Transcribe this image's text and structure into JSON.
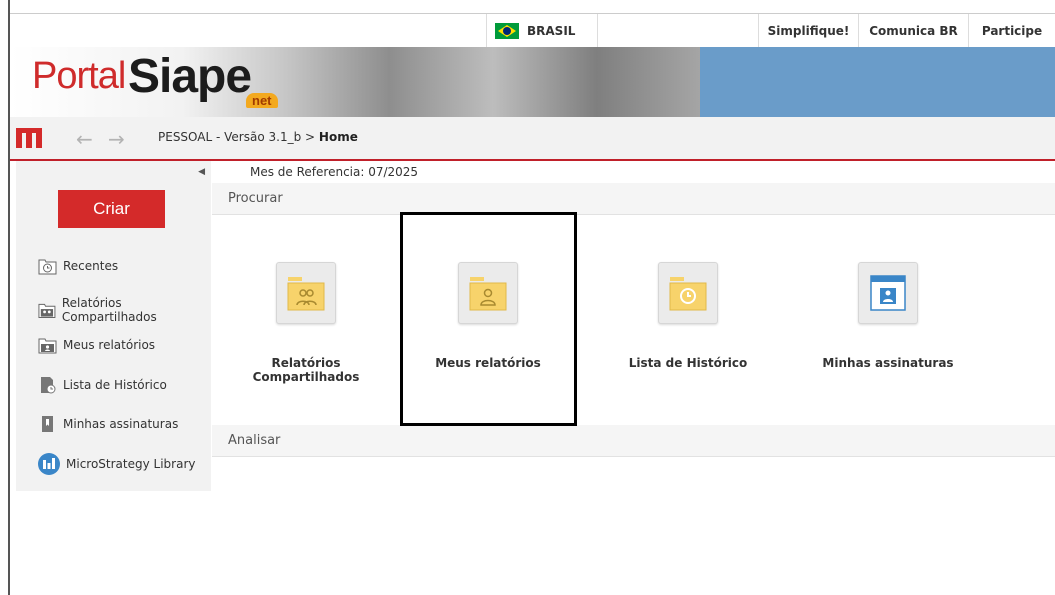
{
  "topbar": {
    "country": "BRASIL",
    "links": [
      "Simplifique!",
      "Comunica BR",
      "Participe"
    ]
  },
  "banner": {
    "logo_portal": "Portal",
    "logo_siape": "Siape",
    "logo_net": "net"
  },
  "nav": {
    "module": "PESSOAL - Versão 3.1_b",
    "separator": ">",
    "current": "Home"
  },
  "sidebar": {
    "create_label": "Criar",
    "items": [
      {
        "label": "Recentes",
        "icon": "clock-folder-icon"
      },
      {
        "label": "Relatórios Compartilhados",
        "icon": "shared-folder-icon"
      },
      {
        "label": "Meus relatórios",
        "icon": "user-folder-icon"
      },
      {
        "label": "Lista de Histórico",
        "icon": "history-doc-icon"
      },
      {
        "label": "Minhas assinaturas",
        "icon": "bookmark-icon"
      },
      {
        "label": "MicroStrategy Library",
        "icon": "library-icon"
      }
    ]
  },
  "main": {
    "reference_month": "Mes de Referencia: 07/2025",
    "sections": [
      {
        "title": "Procurar"
      },
      {
        "title": "Analisar"
      }
    ],
    "tiles": [
      {
        "label": "Relatórios Compartilhados",
        "icon": "shared-folder-icon"
      },
      {
        "label": "Meus relatórios",
        "icon": "user-folder-icon"
      },
      {
        "label": "Lista de Histórico",
        "icon": "history-folder-icon"
      },
      {
        "label": "Minhas assinaturas",
        "icon": "subscription-icon"
      }
    ]
  },
  "colors": {
    "brand_red": "#d42a2a",
    "folder_yellow": "#f7d36b",
    "accent_blue": "#3a86c8"
  }
}
